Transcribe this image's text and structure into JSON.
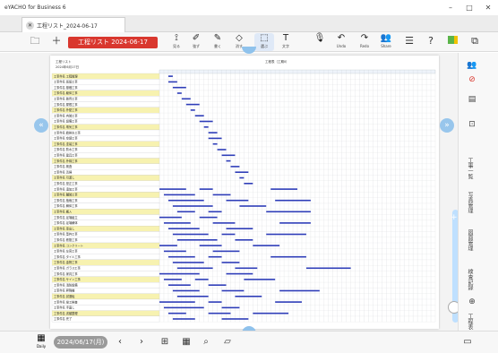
{
  "window": {
    "title": "eYACHO for Business 6",
    "minimize": "–",
    "maximize": "□",
    "close": "✕"
  },
  "tabs": [
    {
      "label": "工程リスト_2024-06-17"
    }
  ],
  "toolbar": {
    "document_title": "工程リスト 2024-06-17",
    "tools": [
      {
        "name": "view-tool",
        "label": "見る",
        "glyph": "⟟"
      },
      {
        "name": "pen-tool",
        "label": "強ず",
        "glyph": "✐"
      },
      {
        "name": "write-tool",
        "label": "書く",
        "glyph": "✎"
      },
      {
        "name": "eraser-tool",
        "label": "消す",
        "glyph": "◇"
      },
      {
        "name": "select-tool",
        "label": "選ぶ",
        "glyph": "⬚"
      },
      {
        "name": "text-tool",
        "label": "文字",
        "glyph": "T"
      },
      {
        "name": "voice-tool",
        "label": "",
        "glyph": "🎙"
      },
      {
        "name": "undo-button",
        "label": "Undo",
        "glyph": "↶"
      },
      {
        "name": "redo-button",
        "label": "Redo",
        "glyph": "↷"
      },
      {
        "name": "share-button",
        "label": "Share",
        "glyph": "👥"
      }
    ]
  },
  "sheet": {
    "header_left": "工程リスト",
    "header_right": "工程表（工期Ⅱ）",
    "date_label": "2024年6月17日",
    "rows": [
      "工事件名 工程管理",
      "工事件名 仮設工事",
      "工事件名 基礎工事",
      "工事件名 躯体工事",
      "工事件名 鉄骨工事",
      "工事件名 屋根工事",
      "工事件名 外壁工事",
      "工事件名 内装工事",
      "工事件名 設備工事",
      "工事件名 電気工事",
      "工事件名 給排水工事",
      "工事件名 空調工事",
      "工事件名 塗装工事",
      "工事件名 防水工事",
      "工事件名 建具工事",
      "工事件名 外構工事",
      "工事件名 検査",
      "工事件名 清掃",
      "工事件名 引渡し",
      "工事件名 是正工事",
      "工事件名 追加工事",
      "工事件名 舗装工事",
      "工事件名 植栽工事",
      "工事件名 解体工事",
      "工事件名 搬入",
      "工事件名 足場組立",
      "工事件名 足場解体",
      "工事件名 墨出し",
      "工事件名 型枠工事",
      "工事件名 鉄筋工事",
      "工事件名 コンクリート",
      "工事件名 左官工事",
      "工事件名 タイル工事",
      "工事件名 金物工事",
      "工事件名 ガラス工事",
      "工事件名 家具工事",
      "工事件名 サイン工事",
      "工事件名 消防設備",
      "工事件名 昇降機",
      "工事件名 試運転",
      "工事件名 竣工検査",
      "工事件名 手直し",
      "工事件名 書類整理",
      "工事件名 完了"
    ]
  },
  "sidebar": {
    "labels": [
      "工事一覧",
      "写真管理",
      "図面管理",
      "検査記録",
      "工程表"
    ]
  },
  "bottombar": {
    "date": "2024/06/17(月)",
    "daily_label": "Daily"
  },
  "colors": {
    "accent": "#d9372e",
    "bar": "#2e3db8",
    "nav": "#8fc2ec",
    "highlight": "#f7f2b0"
  }
}
